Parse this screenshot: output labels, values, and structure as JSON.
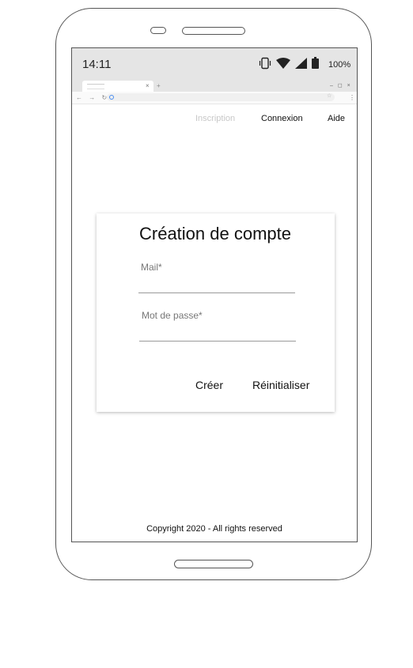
{
  "status_bar": {
    "time": "14:11",
    "battery": "100%",
    "icons": [
      "vibrate-icon",
      "wifi-icon",
      "signal-icon",
      "battery-icon"
    ]
  },
  "browser": {
    "new_tab_symbol": "+",
    "window_controls": "– ◻ ×",
    "nav_symbols": "← → ↻",
    "menu_symbol": "⋮",
    "star_symbol": "☆",
    "tab_close_symbol": "×"
  },
  "topnav": {
    "items": [
      {
        "label": "Inscription",
        "state": "active-muted"
      },
      {
        "label": "Connexion"
      },
      {
        "label": "Aide"
      }
    ]
  },
  "form": {
    "title": "Création de compte",
    "mail": {
      "label": "Mail*",
      "value": ""
    },
    "password": {
      "label": "Mot de passe*",
      "value": ""
    },
    "create_label": "Créer",
    "reset_label": "Réinitialiser"
  },
  "footer": {
    "copyright": "Copyright  2020 - All rights reserved"
  },
  "colors": {
    "statusbar_bg": "#e5e5e5",
    "muted_nav": "#c8c8c8",
    "frame_stroke": "#555555"
  }
}
